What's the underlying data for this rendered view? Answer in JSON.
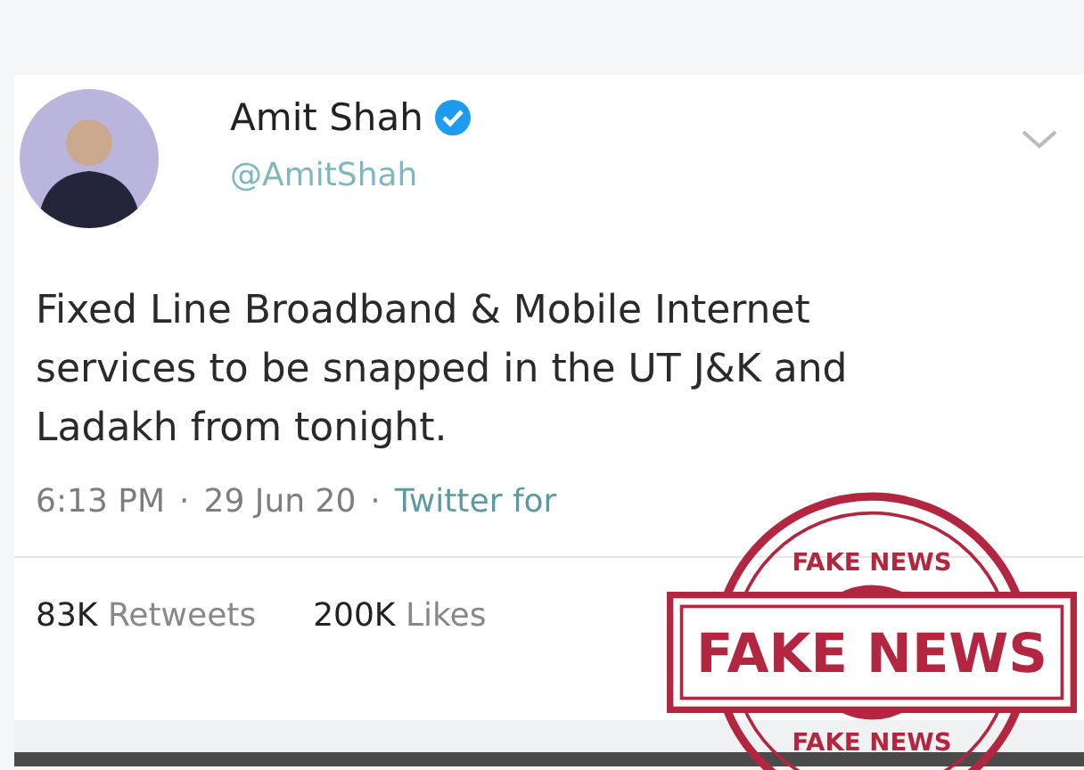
{
  "tweet": {
    "author": {
      "name": "Amit Shah",
      "handle": "@AmitShah",
      "verified": true
    },
    "text": "Fixed Line Broadband & Mobile Internet services to be snapped in the UT J&K and Ladakh from tonight.",
    "meta": {
      "time": "6:13 PM",
      "separator": "·",
      "date": "29 Jun 20",
      "separator_2": "·",
      "source": "Twitter for"
    },
    "stats": [
      {
        "count": "83K",
        "label": "Retweets"
      },
      {
        "count": "200K",
        "label": "Likes"
      }
    ]
  },
  "stamp": {
    "top_arc": "FAKE NEWS",
    "center": "FAKE NEWS",
    "bottom_arc": "FAKE NEWS"
  }
}
